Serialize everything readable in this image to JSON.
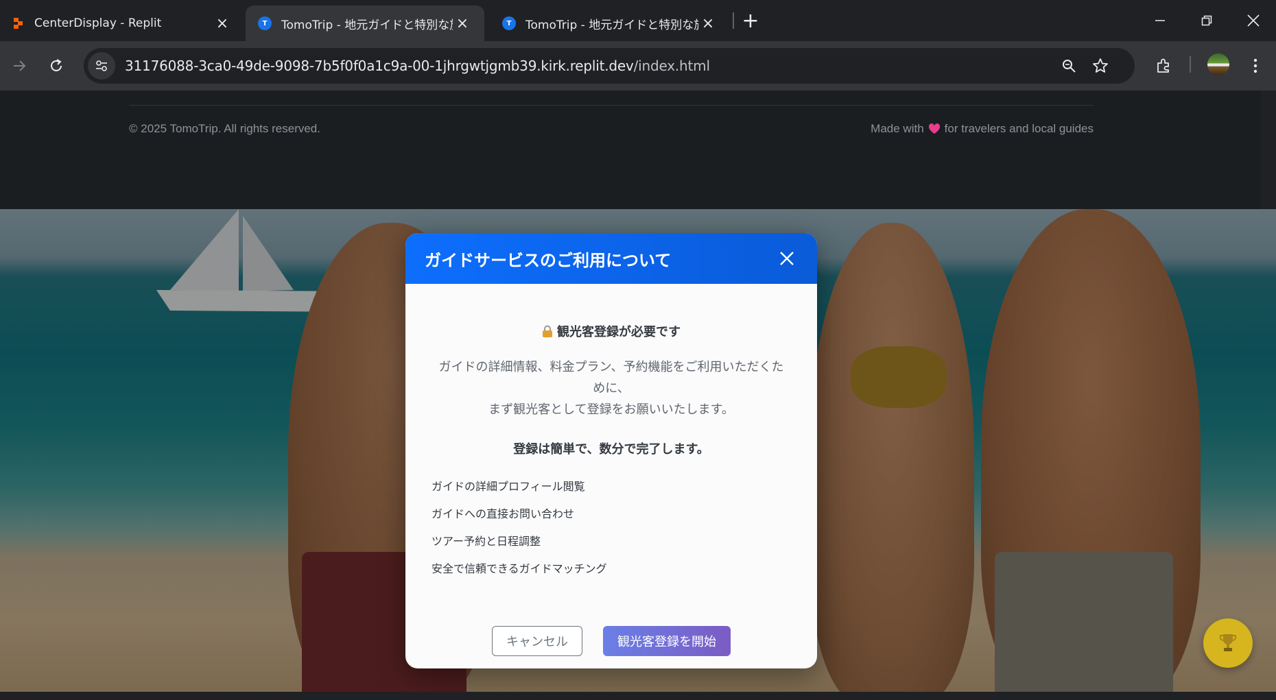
{
  "browser": {
    "tabs": [
      {
        "title": "CenterDisplay - Replit",
        "favicon": "replit-icon",
        "active": false
      },
      {
        "title": "TomoTrip - 地元ガイドと特別な旅",
        "favicon": "tomotrip-icon",
        "active": true
      },
      {
        "title": "TomoTrip - 地元ガイドと特別な旅",
        "favicon": "tomotrip-icon",
        "active": false
      }
    ],
    "favicon_letter": "T",
    "address": {
      "host": "31176088-3ca0-49de-9098-7b5f0f0a1c9a-00-1jhrgwtjgmb39.kirk.replit.dev",
      "path": "/index.html"
    }
  },
  "footer": {
    "copyright": "© 2025 TomoTrip. All rights reserved.",
    "made_with_prefix": "Made with",
    "made_with_suffix": "for travelers and local guides",
    "heart_color": "#e83e8c"
  },
  "modal": {
    "title": "ガイドサービスのご利用について",
    "requirement": "観光客登録が必要です",
    "description_line1": "ガイドの詳細情報、料金プラン、予約機能をご利用いただくた",
    "description_line2": "めに、",
    "description_line3": "まず観光客として登録をお願いいたします。",
    "easy_note": "登録は簡単で、数分で完了します。",
    "benefits": [
      "ガイドの詳細プロフィール閲覧",
      "ガイドへの直接お問い合わせ",
      "ツアー予約と日程調整",
      "安全で信頼できるガイドマッチング"
    ],
    "cancel_label": "キャンセル",
    "start_label": "観光客登録を開始"
  },
  "colors": {
    "modal_header": "#0d6efd",
    "start_button_from": "#6a7fe6",
    "start_button_to": "#7b5cc4",
    "fab": "#d6b51e"
  }
}
